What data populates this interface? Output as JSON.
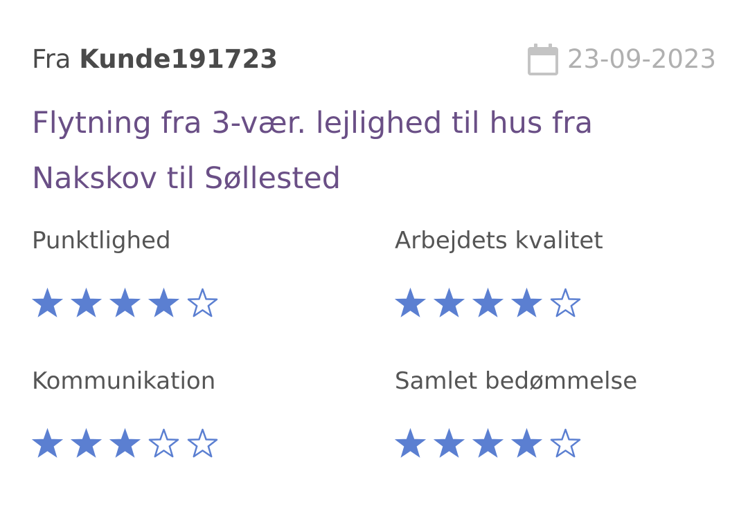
{
  "review": {
    "from_prefix": "Fra",
    "author": "Kunde191723",
    "date": "23-09-2023",
    "date_icon": "calendar-icon",
    "title": "Flytning fra 3-vær. lejlighed til hus fra Nakskov til Søllested"
  },
  "ratings": [
    {
      "label": "Punktlighed",
      "stars": 4,
      "max": 5
    },
    {
      "label": "Arbejdets kvalitet",
      "stars": 4,
      "max": 5
    },
    {
      "label": "Kommunikation",
      "stars": 3,
      "max": 5
    },
    {
      "label": "Samlet bedømmelse",
      "stars": 4,
      "max": 5
    }
  ],
  "colors": {
    "title": "#6a4f86",
    "star": "#5b7fd1",
    "date": "#b0b0b0",
    "text": "#4a4a4a"
  }
}
